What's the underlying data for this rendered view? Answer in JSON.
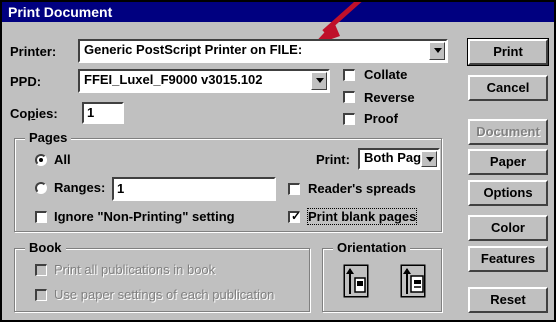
{
  "window": {
    "title": "Print Document"
  },
  "printer": {
    "label": "Printer:",
    "value": "Generic PostScript Printer on FILE:"
  },
  "ppd": {
    "label": "PPD:",
    "value": "FFEI_Luxel_F9000 v3015.102"
  },
  "copies": {
    "label": "Copies:",
    "value": "1"
  },
  "options": {
    "collate": "Collate",
    "reverse": "Reverse",
    "proof": "Proof"
  },
  "pages": {
    "title": "Pages",
    "all": "All",
    "ranges_label": "Ranges:",
    "ranges_value": "1",
    "ignore": "Ignore \"Non-Printing\" setting",
    "print_label": "Print:",
    "print_value": "Both Pages",
    "readers": "Reader's spreads",
    "blank": "Print blank pages"
  },
  "book": {
    "title": "Book",
    "all_pubs": "Print all publications in book",
    "paper_settings": "Use paper settings of each publication"
  },
  "orientation": {
    "title": "Orientation"
  },
  "buttons": {
    "print": "Print",
    "cancel": "Cancel",
    "document": "Document",
    "paper": "Paper",
    "options": "Options",
    "color": "Color",
    "features": "Features",
    "reset": "Reset"
  },
  "colors": {
    "titlebar": "#000080",
    "annotation_arrow": "#c0102a"
  }
}
